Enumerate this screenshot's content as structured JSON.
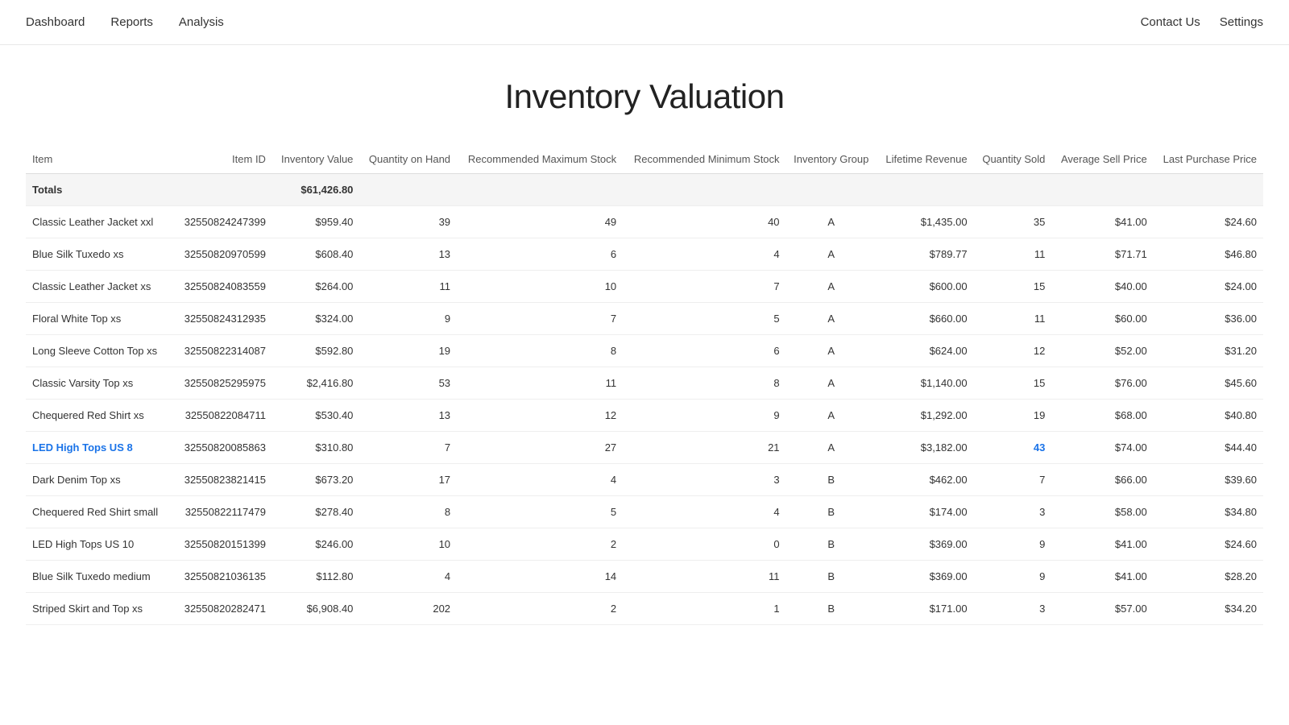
{
  "nav": {
    "left_items": [
      "Dashboard",
      "Reports",
      "Analysis"
    ],
    "right_items": [
      "Contact Us",
      "Settings"
    ]
  },
  "page": {
    "title": "Inventory Valuation"
  },
  "table": {
    "columns": [
      "Item",
      "Item ID",
      "Inventory Value",
      "Quantity on Hand",
      "Recommended Maximum Stock",
      "Recommended Minimum Stock",
      "Inventory Group",
      "Lifetime Revenue",
      "Quantity Sold",
      "Average Sell Price",
      "Last Purchase Price"
    ],
    "totals": {
      "label": "Totals",
      "inventory_value": "$61,426.80"
    },
    "rows": [
      {
        "item": "Classic Leather Jacket xxl",
        "item_id": "32550824247399",
        "inventory_value": "$959.40",
        "quantity_on_hand": "39",
        "rec_max_stock": "49",
        "rec_min_stock": "40",
        "inventory_group": "A",
        "lifetime_revenue": "$1,435.00",
        "quantity_sold": "35",
        "avg_sell_price": "$41.00",
        "last_purchase_price": "$24.60",
        "highlight": false
      },
      {
        "item": "Blue Silk Tuxedo xs",
        "item_id": "32550820970599",
        "inventory_value": "$608.40",
        "quantity_on_hand": "13",
        "rec_max_stock": "6",
        "rec_min_stock": "4",
        "inventory_group": "A",
        "lifetime_revenue": "$789.77",
        "quantity_sold": "11",
        "avg_sell_price": "$71.71",
        "last_purchase_price": "$46.80",
        "highlight": false
      },
      {
        "item": "Classic Leather Jacket xs",
        "item_id": "32550824083559",
        "inventory_value": "$264.00",
        "quantity_on_hand": "11",
        "rec_max_stock": "10",
        "rec_min_stock": "7",
        "inventory_group": "A",
        "lifetime_revenue": "$600.00",
        "quantity_sold": "15",
        "avg_sell_price": "$40.00",
        "last_purchase_price": "$24.00",
        "highlight": false
      },
      {
        "item": "Floral White Top xs",
        "item_id": "32550824312935",
        "inventory_value": "$324.00",
        "quantity_on_hand": "9",
        "rec_max_stock": "7",
        "rec_min_stock": "5",
        "inventory_group": "A",
        "lifetime_revenue": "$660.00",
        "quantity_sold": "11",
        "avg_sell_price": "$60.00",
        "last_purchase_price": "$36.00",
        "highlight": false
      },
      {
        "item": "Long Sleeve Cotton Top xs",
        "item_id": "32550822314087",
        "inventory_value": "$592.80",
        "quantity_on_hand": "19",
        "rec_max_stock": "8",
        "rec_min_stock": "6",
        "inventory_group": "A",
        "lifetime_revenue": "$624.00",
        "quantity_sold": "12",
        "avg_sell_price": "$52.00",
        "last_purchase_price": "$31.20",
        "highlight": false
      },
      {
        "item": "Classic Varsity Top xs",
        "item_id": "32550825295975",
        "inventory_value": "$2,416.80",
        "quantity_on_hand": "53",
        "rec_max_stock": "11",
        "rec_min_stock": "8",
        "inventory_group": "A",
        "lifetime_revenue": "$1,140.00",
        "quantity_sold": "15",
        "avg_sell_price": "$76.00",
        "last_purchase_price": "$45.60",
        "highlight": false
      },
      {
        "item": "Chequered Red Shirt xs",
        "item_id": "32550822084711",
        "inventory_value": "$530.40",
        "quantity_on_hand": "13",
        "rec_max_stock": "12",
        "rec_min_stock": "9",
        "inventory_group": "A",
        "lifetime_revenue": "$1,292.00",
        "quantity_sold": "19",
        "avg_sell_price": "$68.00",
        "last_purchase_price": "$40.80",
        "highlight": false
      },
      {
        "item": "LED High Tops US 8",
        "item_id": "32550820085863",
        "inventory_value": "$310.80",
        "quantity_on_hand": "7",
        "rec_max_stock": "27",
        "rec_min_stock": "21",
        "inventory_group": "A",
        "lifetime_revenue": "$3,182.00",
        "quantity_sold": "43",
        "avg_sell_price": "$74.00",
        "last_purchase_price": "$44.40",
        "highlight": true
      },
      {
        "item": "Dark Denim Top xs",
        "item_id": "32550823821415",
        "inventory_value": "$673.20",
        "quantity_on_hand": "17",
        "rec_max_stock": "4",
        "rec_min_stock": "3",
        "inventory_group": "B",
        "lifetime_revenue": "$462.00",
        "quantity_sold": "7",
        "avg_sell_price": "$66.00",
        "last_purchase_price": "$39.60",
        "highlight": false
      },
      {
        "item": "Chequered Red Shirt small",
        "item_id": "32550822117479",
        "inventory_value": "$278.40",
        "quantity_on_hand": "8",
        "rec_max_stock": "5",
        "rec_min_stock": "4",
        "inventory_group": "B",
        "lifetime_revenue": "$174.00",
        "quantity_sold": "3",
        "avg_sell_price": "$58.00",
        "last_purchase_price": "$34.80",
        "highlight": false
      },
      {
        "item": "LED High Tops US 10",
        "item_id": "32550820151399",
        "inventory_value": "$246.00",
        "quantity_on_hand": "10",
        "rec_max_stock": "2",
        "rec_min_stock": "0",
        "inventory_group": "B",
        "lifetime_revenue": "$369.00",
        "quantity_sold": "9",
        "avg_sell_price": "$41.00",
        "last_purchase_price": "$24.60",
        "highlight": false
      },
      {
        "item": "Blue Silk Tuxedo medium",
        "item_id": "32550821036135",
        "inventory_value": "$112.80",
        "quantity_on_hand": "4",
        "rec_max_stock": "14",
        "rec_min_stock": "11",
        "inventory_group": "B",
        "lifetime_revenue": "$369.00",
        "quantity_sold": "9",
        "avg_sell_price": "$41.00",
        "last_purchase_price": "$28.20",
        "highlight": false
      },
      {
        "item": "Striped Skirt and Top xs",
        "item_id": "32550820282471",
        "inventory_value": "$6,908.40",
        "quantity_on_hand": "202",
        "rec_max_stock": "2",
        "rec_min_stock": "1",
        "inventory_group": "B",
        "lifetime_revenue": "$171.00",
        "quantity_sold": "3",
        "avg_sell_price": "$57.00",
        "last_purchase_price": "$34.20",
        "highlight": false
      }
    ]
  }
}
